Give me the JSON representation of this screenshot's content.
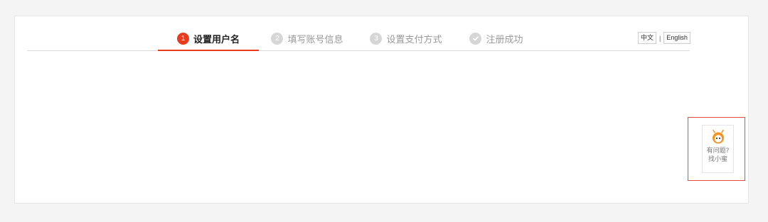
{
  "steps": [
    {
      "number": "1",
      "label": "设置用户名",
      "state": "active"
    },
    {
      "number": "2",
      "label": "填写账号信息",
      "state": "pending"
    },
    {
      "number": "3",
      "label": "设置支付方式",
      "state": "pending"
    },
    {
      "icon": "check-circle-icon",
      "label": "注册成功",
      "state": "pending"
    }
  ],
  "language": {
    "chinese": "中文",
    "separator": "|",
    "english": "English"
  },
  "help": {
    "line1": "有问题?",
    "line2": "找小蜜",
    "icon": "mascot-icon"
  },
  "colors": {
    "accent": "#e83a1c",
    "inactive": "#d6d6d6",
    "highlight_border": "#e74a3c"
  }
}
